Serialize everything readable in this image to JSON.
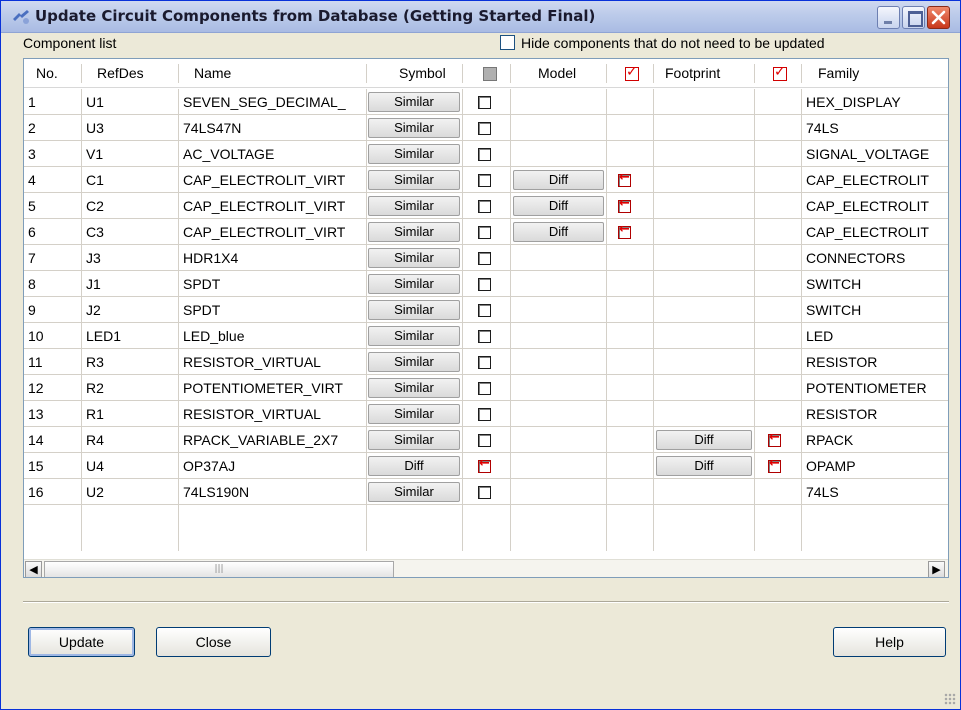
{
  "window": {
    "title": "Update Circuit Components from Database (Getting Started Final)"
  },
  "component_list_label": "Component list",
  "hide_checkbox": {
    "label": "Hide components that do not need to be updated",
    "checked": false
  },
  "columns": {
    "no": "No.",
    "refdes": "RefDes",
    "name": "Name",
    "symbol": "Symbol",
    "model": "Model",
    "footprint": "Footprint",
    "family": "Family"
  },
  "header_checks": {
    "symbol": "indeterminate",
    "model": "checked",
    "footprint": "checked"
  },
  "rows": [
    {
      "no": "1",
      "refdes": "U1",
      "name": "SEVEN_SEG_DECIMAL_",
      "symbol": "Similar",
      "symbol_chk": false,
      "model": "",
      "model_chk": null,
      "footprint": "",
      "footprint_chk": null,
      "family": "HEX_DISPLAY"
    },
    {
      "no": "2",
      "refdes": "U3",
      "name": "74LS47N",
      "symbol": "Similar",
      "symbol_chk": false,
      "model": "",
      "model_chk": null,
      "footprint": "",
      "footprint_chk": null,
      "family": "74LS"
    },
    {
      "no": "3",
      "refdes": "V1",
      "name": "AC_VOLTAGE",
      "symbol": "Similar",
      "symbol_chk": false,
      "model": "",
      "model_chk": null,
      "footprint": "",
      "footprint_chk": null,
      "family": "SIGNAL_VOLTAGE"
    },
    {
      "no": "4",
      "refdes": "C1",
      "name": "CAP_ELECTROLIT_VIRT",
      "symbol": "Similar",
      "symbol_chk": false,
      "model": "Diff",
      "model_chk": true,
      "footprint": "",
      "footprint_chk": null,
      "family": "CAP_ELECTROLIT"
    },
    {
      "no": "5",
      "refdes": "C2",
      "name": "CAP_ELECTROLIT_VIRT",
      "symbol": "Similar",
      "symbol_chk": false,
      "model": "Diff",
      "model_chk": true,
      "footprint": "",
      "footprint_chk": null,
      "family": "CAP_ELECTROLIT"
    },
    {
      "no": "6",
      "refdes": "C3",
      "name": "CAP_ELECTROLIT_VIRT",
      "symbol": "Similar",
      "symbol_chk": false,
      "model": "Diff",
      "model_chk": true,
      "footprint": "",
      "footprint_chk": null,
      "family": "CAP_ELECTROLIT"
    },
    {
      "no": "7",
      "refdes": "J3",
      "name": "HDR1X4",
      "symbol": "Similar",
      "symbol_chk": false,
      "model": "",
      "model_chk": null,
      "footprint": "",
      "footprint_chk": null,
      "family": "CONNECTORS"
    },
    {
      "no": "8",
      "refdes": "J1",
      "name": "SPDT",
      "symbol": "Similar",
      "symbol_chk": false,
      "model": "",
      "model_chk": null,
      "footprint": "",
      "footprint_chk": null,
      "family": "SWITCH"
    },
    {
      "no": "9",
      "refdes": "J2",
      "name": "SPDT",
      "symbol": "Similar",
      "symbol_chk": false,
      "model": "",
      "model_chk": null,
      "footprint": "",
      "footprint_chk": null,
      "family": "SWITCH"
    },
    {
      "no": "10",
      "refdes": "LED1",
      "name": "LED_blue",
      "symbol": "Similar",
      "symbol_chk": false,
      "model": "",
      "model_chk": null,
      "footprint": "",
      "footprint_chk": null,
      "family": "LED"
    },
    {
      "no": "11",
      "refdes": "R3",
      "name": "RESISTOR_VIRTUAL",
      "symbol": "Similar",
      "symbol_chk": false,
      "model": "",
      "model_chk": null,
      "footprint": "",
      "footprint_chk": null,
      "family": "RESISTOR"
    },
    {
      "no": "12",
      "refdes": "R2",
      "name": "POTENTIOMETER_VIRT",
      "symbol": "Similar",
      "symbol_chk": false,
      "model": "",
      "model_chk": null,
      "footprint": "",
      "footprint_chk": null,
      "family": "POTENTIOMETER"
    },
    {
      "no": "13",
      "refdes": "R1",
      "name": "RESISTOR_VIRTUAL",
      "symbol": "Similar",
      "symbol_chk": false,
      "model": "",
      "model_chk": null,
      "footprint": "",
      "footprint_chk": null,
      "family": "RESISTOR"
    },
    {
      "no": "14",
      "refdes": "R4",
      "name": "RPACK_VARIABLE_2X7",
      "symbol": "Similar",
      "symbol_chk": false,
      "model": "",
      "model_chk": null,
      "footprint": "Diff",
      "footprint_chk": true,
      "family": "RPACK"
    },
    {
      "no": "15",
      "refdes": "U4",
      "name": "OP37AJ",
      "symbol": "Diff",
      "symbol_chk": true,
      "model": "",
      "model_chk": null,
      "footprint": "Diff",
      "footprint_chk": true,
      "family": "OPAMP"
    },
    {
      "no": "16",
      "refdes": "U2",
      "name": "74LS190N",
      "symbol": "Similar",
      "symbol_chk": false,
      "model": "",
      "model_chk": null,
      "footprint": "",
      "footprint_chk": null,
      "family": "74LS"
    }
  ],
  "scrollbar": {
    "thumb_grip": "|||"
  },
  "buttons": {
    "update": "Update",
    "close": "Close",
    "help": "Help"
  },
  "colors": {
    "title_gradient": "#bccbea",
    "accent_red": "#e00000",
    "grid_border": "#7f9db9",
    "dialog_bg": "#ece9d8"
  }
}
